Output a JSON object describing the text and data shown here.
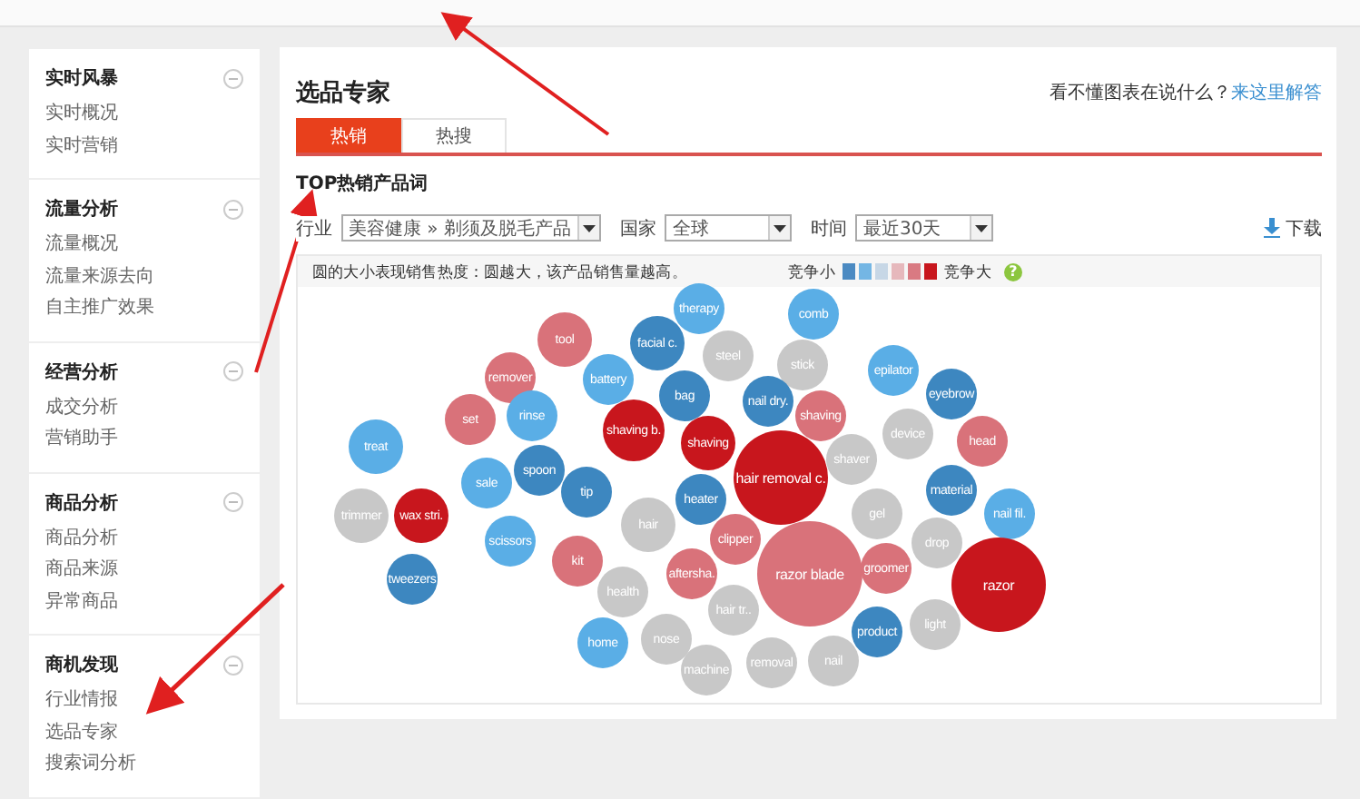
{
  "sidebar": {
    "sections": [
      {
        "title": "实时风暴",
        "expanded": true,
        "items": [
          "实时概况",
          "实时营销"
        ]
      },
      {
        "title": "流量分析",
        "expanded": true,
        "items": [
          "流量概况",
          "流量来源去向",
          "自主推广效果"
        ]
      },
      {
        "title": "经营分析",
        "expanded": true,
        "items": [
          "成交分析",
          "营销助手"
        ]
      },
      {
        "title": "商品分析",
        "expanded": true,
        "items": [
          "商品分析",
          "商品来源",
          "异常商品"
        ]
      },
      {
        "title": "商机发现",
        "expanded": true,
        "items": [
          "行业情报",
          "选品专家",
          "搜索词分析"
        ]
      }
    ]
  },
  "page": {
    "title": "选品专家",
    "help_text": "看不懂图表在说什么？",
    "help_link": "来这里解答"
  },
  "tabs": [
    {
      "label": "热销",
      "selected": true
    },
    {
      "label": "热搜",
      "selected": false
    }
  ],
  "section_title": "TOP热销产品词",
  "filters": [
    {
      "label": "行业",
      "value": "美容健康 » 剃须及脱毛产品"
    },
    {
      "label": "国家",
      "value": "全球"
    },
    {
      "label": "时间",
      "value": "最近30天"
    }
  ],
  "download": "下载",
  "legend": {
    "note": "圆的大小表现销售热度：圆越大，该产品销售量越高。",
    "low": "竞争小",
    "high": "竞争大",
    "help": "?",
    "swatches": [
      {
        "color": "#4b8ac2"
      },
      {
        "color": "#74b6e4"
      },
      {
        "color": "#c7d7e6"
      },
      {
        "color": "#e6b8bc"
      },
      {
        "color": "#d97a82"
      },
      {
        "color": "#c8161d"
      }
    ]
  },
  "bubbles": [
    {
      "label": "therapy",
      "color": "#5aaee6"
    },
    {
      "label": "comb",
      "color": "#5aaee6"
    },
    {
      "label": "tool",
      "color": "#d9727a"
    },
    {
      "label": "facial c.",
      "color": "#3d87c0"
    },
    {
      "label": "steel",
      "color": "#c8c8c8"
    },
    {
      "label": "stick",
      "color": "#c8c8c8"
    },
    {
      "label": "remover",
      "color": "#d9727a"
    },
    {
      "label": "battery",
      "color": "#5aaee6"
    },
    {
      "label": "bag",
      "color": "#3d87c0"
    },
    {
      "label": "nail dry.",
      "color": "#3d87c0"
    },
    {
      "label": "epilator",
      "color": "#5aaee6"
    },
    {
      "label": "eyebrow",
      "color": "#3d87c0"
    },
    {
      "label": "treat",
      "color": "#5aaee6"
    },
    {
      "label": "set",
      "color": "#d9727a"
    },
    {
      "label": "rinse",
      "color": "#5aaee6"
    },
    {
      "label": "shaving b.",
      "color": "#c8161d"
    },
    {
      "label": "shaving",
      "color": "#c8161d"
    },
    {
      "label": "shaving",
      "color": "#d9727a"
    },
    {
      "label": "device",
      "color": "#c8c8c8"
    },
    {
      "label": "head",
      "color": "#d9727a"
    },
    {
      "label": "sale",
      "color": "#5aaee6"
    },
    {
      "label": "spoon",
      "color": "#3d87c0"
    },
    {
      "label": "tip",
      "color": "#3d87c0"
    },
    {
      "label": "heater",
      "color": "#3d87c0"
    },
    {
      "label": "hair removal c.",
      "color": "#c8161d"
    },
    {
      "label": "shaver",
      "color": "#c8c8c8"
    },
    {
      "label": "material",
      "color": "#3d87c0"
    },
    {
      "label": "trimmer",
      "color": "#c8c8c8"
    },
    {
      "label": "wax stri.",
      "color": "#c8161d"
    },
    {
      "label": "scissors",
      "color": "#5aaee6"
    },
    {
      "label": "hair",
      "color": "#c8c8c8"
    },
    {
      "label": "clipper",
      "color": "#d9727a"
    },
    {
      "label": "gel",
      "color": "#c8c8c8"
    },
    {
      "label": "drop",
      "color": "#c8c8c8"
    },
    {
      "label": "nail fil.",
      "color": "#5aaee6"
    },
    {
      "label": "tweezers",
      "color": "#3d87c0"
    },
    {
      "label": "kit",
      "color": "#d9727a"
    },
    {
      "label": "aftersha.",
      "color": "#d9727a"
    },
    {
      "label": "razor blade",
      "color": "#d9727a"
    },
    {
      "label": "groomer",
      "color": "#d9727a"
    },
    {
      "label": "health",
      "color": "#c8c8c8"
    },
    {
      "label": "hair tr..",
      "color": "#c8c8c8"
    },
    {
      "label": "product",
      "color": "#3d87c0"
    },
    {
      "label": "light",
      "color": "#c8c8c8"
    },
    {
      "label": "razor",
      "color": "#c8161d"
    },
    {
      "label": "home",
      "color": "#5aaee6"
    },
    {
      "label": "nose",
      "color": "#c8c8c8"
    },
    {
      "label": "machine",
      "color": "#c8c8c8"
    },
    {
      "label": "removal",
      "color": "#c8c8c8"
    },
    {
      "label": "nail",
      "color": "#c8c8c8"
    }
  ]
}
